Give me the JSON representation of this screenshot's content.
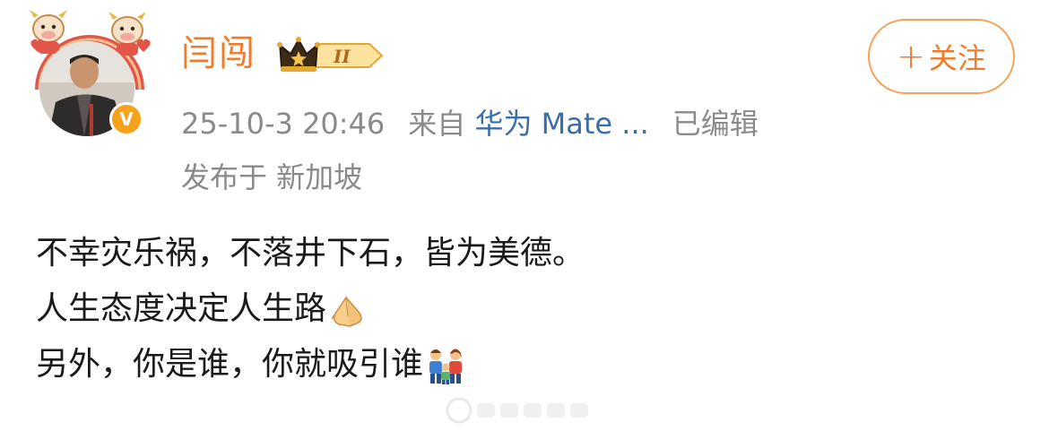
{
  "post": {
    "username": "闫闯",
    "follow_label": "关注",
    "follow_icon": "plus-icon",
    "timestamp": "25-10-3 20:46",
    "source_prefix": "来自",
    "source_device": "华为 Mate ...",
    "edited_label": "已编辑",
    "location": "发布于 新加坡",
    "body_lines": [
      "不幸灾乐祸，不落井下石，皆为美德。",
      "人生态度决定人生路",
      "另外，你是谁，你就吸引谁"
    ],
    "line2_emoji": "pray-hands-emoji",
    "line3_emoji": "family-emoji"
  },
  "badges": {
    "vip_level": "II",
    "verified_mark": "V"
  },
  "colors": {
    "accent": "#f07c2a",
    "follow_border": "#f5a35a",
    "meta_gray": "#8a8a8a",
    "link_blue": "#3b6ea8",
    "text": "#1a1a1a"
  }
}
